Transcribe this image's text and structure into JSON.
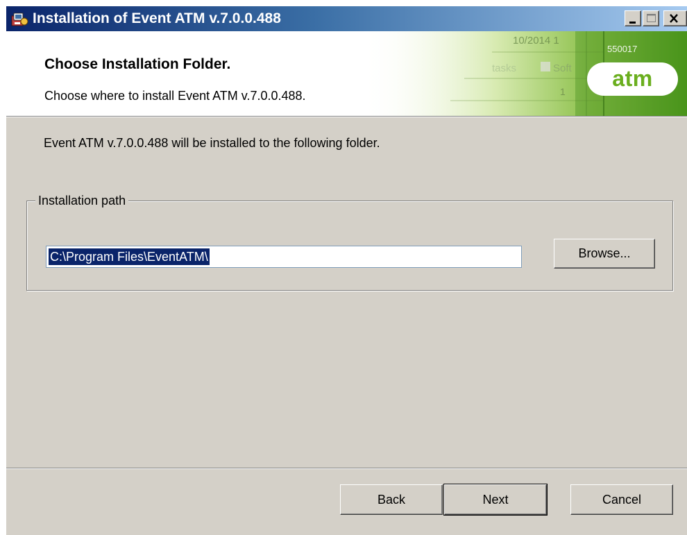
{
  "window": {
    "title": "Installation of Event ATM v.7.0.0.488",
    "controls": [
      "minimize",
      "maximize",
      "close"
    ]
  },
  "banner": {
    "heading": "Choose Installation Folder.",
    "subheading": "Choose where to install Event ATM v.7.0.0.488.",
    "logo_text": "atm",
    "background_fragments": [
      "10/2014 1",
      "550017",
      "Soft",
      "tasks",
      "1"
    ]
  },
  "content": {
    "description": "Event ATM v.7.0.0.488 will be installed to the following folder.",
    "group_label": "Installation path",
    "path_value": "C:\\Program Files\\EventATM\\",
    "browse_label": "Browse..."
  },
  "footer": {
    "back_label": "Back",
    "next_label": "Next",
    "cancel_label": "Cancel"
  },
  "colors": {
    "titlebar_start": "#0a246a",
    "titlebar_end": "#a6caf0",
    "dialog_face": "#d4d0c8",
    "logo_green": "#6aae1e",
    "selection": "#0a246a"
  }
}
